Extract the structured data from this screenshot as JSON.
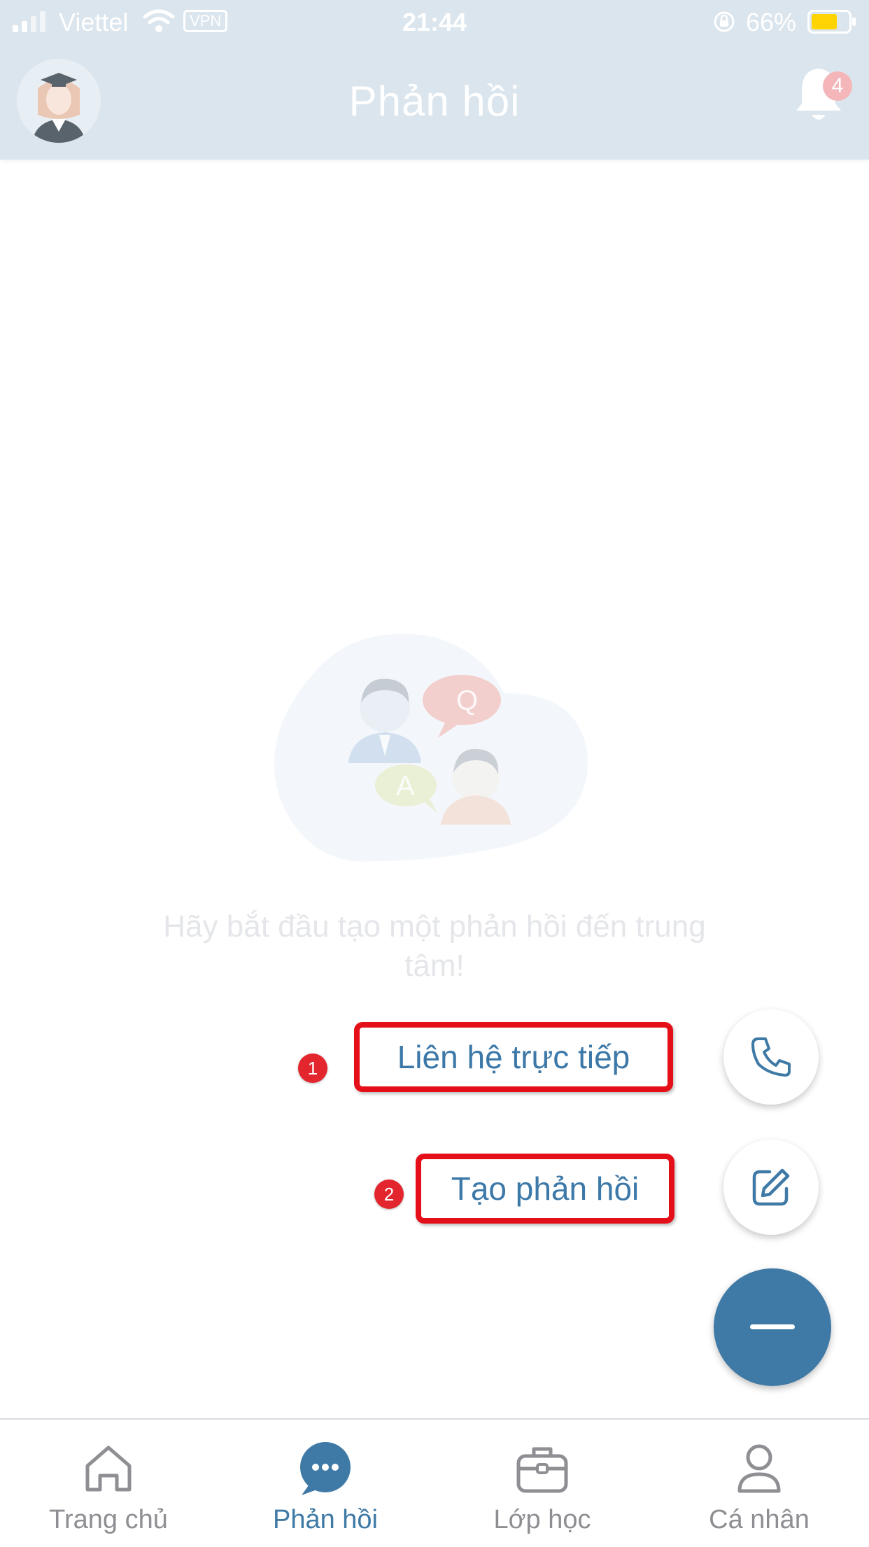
{
  "status_bar": {
    "carrier": "Viettel",
    "vpn": "VPN",
    "time": "21:44",
    "battery": "66%"
  },
  "header": {
    "title": "Phản hồi",
    "notification_count": "4"
  },
  "empty_state": {
    "message": "Hãy bắt đầu tạo một phản hồi đến trung tâm!",
    "illustration_letters": [
      "Q",
      "A"
    ]
  },
  "actions": [
    {
      "badge": "1",
      "label": "Liên hệ trực tiếp",
      "icon": "phone-icon"
    },
    {
      "badge": "2",
      "label": "Tạo phản hồi",
      "icon": "edit-icon"
    }
  ],
  "tabs": [
    {
      "label": "Trang chủ",
      "icon": "home-icon",
      "active": false
    },
    {
      "label": "Phản hồi",
      "icon": "chat-bubble-icon",
      "active": true
    },
    {
      "label": "Lớp học",
      "icon": "briefcase-icon",
      "active": false
    },
    {
      "label": "Cá nhân",
      "icon": "person-icon",
      "active": false
    }
  ],
  "colors": {
    "accent": "#3f7aa6",
    "header_bg": "#dbe5ed",
    "highlight_border": "#e50f1a",
    "badge_red": "#e3262e"
  }
}
